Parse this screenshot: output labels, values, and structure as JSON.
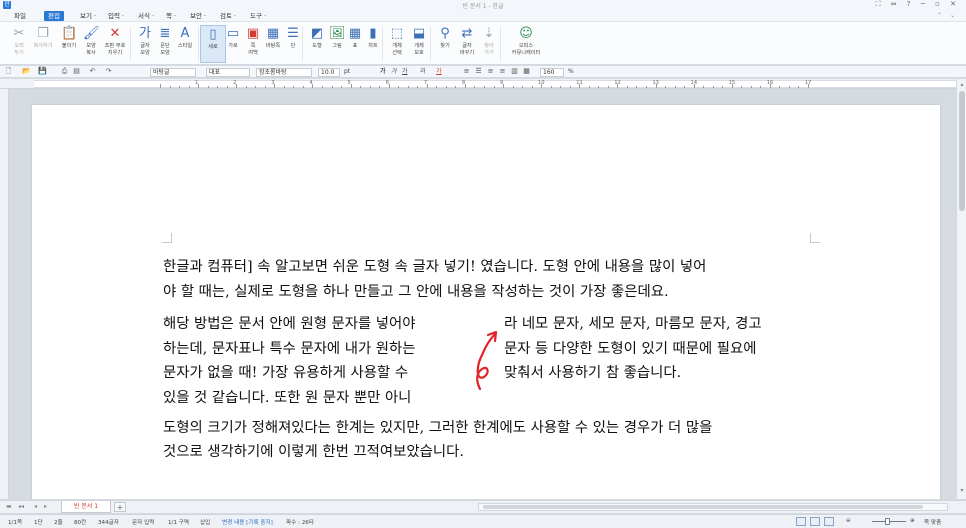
{
  "window": {
    "app_logo": "한",
    "title": "빈 문서 1 - 한글",
    "controls": "⛶ ⇔ ?  ─ ▫ ✕"
  },
  "menubar": {
    "items": [
      {
        "label": "파일",
        "active": false
      },
      {
        "label": "편집",
        "active": true
      },
      {
        "label": "보기 ·",
        "active": false
      },
      {
        "label": "입력 ·",
        "active": false
      },
      {
        "label": "서식 ·",
        "active": false
      },
      {
        "label": "쪽 ·",
        "active": false
      },
      {
        "label": "보안 ·",
        "active": false
      },
      {
        "label": "검토 ·",
        "active": false
      },
      {
        "label": "도구 ·",
        "active": false
      }
    ],
    "ribbon_arrows": "⌃ ⌄"
  },
  "ribbon": {
    "buttons": [
      {
        "name": "cut",
        "icon": "scissors-icon",
        "glyph": "✂",
        "label": "오려\n두기",
        "dim": true
      },
      {
        "name": "copy",
        "icon": "copy-icon",
        "glyph": "❐",
        "label": "복사하기",
        "dim": true
      },
      {
        "name": "paste",
        "icon": "paste-icon",
        "glyph": "📋",
        "label": "붙이기"
      },
      {
        "name": "shape-copy",
        "icon": "format-copy-icon",
        "glyph": "🖌",
        "label": "모양\n복사"
      },
      {
        "name": "delete-condition",
        "icon": "delete-x-icon",
        "glyph": "✕",
        "label": "조판 부호\n지우기"
      },
      {
        "name": "char-shape",
        "icon": "char-shape-icon",
        "glyph": "가",
        "label": "글자\n모양"
      },
      {
        "name": "para-shape",
        "icon": "para-shape-icon",
        "glyph": "≣",
        "label": "문단\n모양"
      },
      {
        "name": "style",
        "icon": "style-icon",
        "glyph": "A",
        "label": "스타일"
      },
      {
        "name": "portrait",
        "icon": "portrait-page-icon",
        "glyph": "▯",
        "label": "세로",
        "selected": true
      },
      {
        "name": "landscape",
        "icon": "landscape-page-icon",
        "glyph": "▭",
        "label": "가로"
      },
      {
        "name": "margin",
        "icon": "page-margin-icon",
        "glyph": "▣",
        "label": "쪽\n여백"
      },
      {
        "name": "bg",
        "icon": "page-bg-icon",
        "glyph": "▦",
        "label": "바탕쪽"
      },
      {
        "name": "columns",
        "icon": "columns-icon",
        "glyph": "☰",
        "label": "단"
      },
      {
        "name": "shape",
        "icon": "shape-icon",
        "glyph": "◩",
        "label": "도형"
      },
      {
        "name": "picture",
        "icon": "picture-icon",
        "glyph": "🖼",
        "label": "그림"
      },
      {
        "name": "table",
        "icon": "table-icon",
        "glyph": "▦",
        "label": "표"
      },
      {
        "name": "chart",
        "icon": "chart-icon",
        "glyph": "▮",
        "label": "차트"
      },
      {
        "name": "select-object",
        "icon": "object-select-icon",
        "glyph": "⬚",
        "label": "개체\n선택"
      },
      {
        "name": "object-protect",
        "icon": "object-protect-icon",
        "glyph": "⬓",
        "label": "개체\n보호"
      },
      {
        "name": "find",
        "icon": "binoculars-icon",
        "glyph": "⚲",
        "label": "찾기"
      },
      {
        "name": "replace",
        "icon": "replace-icon",
        "glyph": "⇄",
        "label": "글자\n바꾸기"
      },
      {
        "name": "goto",
        "icon": "goto-icon",
        "glyph": "⇣",
        "label": "찾아\n가기",
        "dim": true
      },
      {
        "name": "office",
        "icon": "office-comm-icon",
        "glyph": "☺",
        "label": "오피스\n커뮤니케이터"
      }
    ]
  },
  "format_toolbar": {
    "style_value": "바탕글",
    "lang_value": "대표",
    "font_value": "함초롬바탕",
    "size_value": "10.0",
    "size_unit": "pt",
    "zoom_value": "160",
    "zoom_unit": "%",
    "bold": "가",
    "italic": "가",
    "underline": "가",
    "strike": "과",
    "color_text": "가"
  },
  "ruler": {
    "numbers": [
      "1",
      "2",
      "3",
      "4",
      "5",
      "6",
      "7",
      "8",
      "9",
      "10",
      "11",
      "12",
      "13",
      "14",
      "15",
      "16",
      "17"
    ]
  },
  "document": {
    "lines": [
      "한글과 컴퓨터] 속 알고보면 쉬운 도형 속 글자 넣기! 였습니다. 도형 안에 내용을 많이 넣어",
      "야 할 때는, 실제로 도형을 하나 만들고 그 안에 내용을 작성하는 것이 가장 좋은데요.",
      "해당 방법은 문서 안에 원형  문자를 넣어야",
      "하는데, 문자표나 특수 문자에 내가 원하는",
      "문자가 없을 때! 가장 유용하게 사용할 수",
      "있을 것 같습니다. 또한 원 문자 뿐만 아니",
      "라 네모 문자, 세모 문자, 마름모 문자, 경고",
      "문자 등 다양한 도형이 있기 때문에 필요에",
      "맞춰서 사용하기 참 좋습니다.",
      "도형의 크기가 정해져있다는 한계는 있지만, 그러한 한계에도 사용할 수 있는 경우가 더 많을",
      "것으로 생각하기에 이렇게 한번 끄적여보았습니다."
    ],
    "annotation_color": "#e0242a"
  },
  "tabbar": {
    "doc_tab": "빈 문서 1",
    "add_tab": "+"
  },
  "status": {
    "page": "1/1쪽",
    "col": "1단",
    "line": "2줄",
    "chars": "80칸",
    "count": "344글자",
    "input": "문자 입력",
    "section": "1/1 구역",
    "mode": "삽입",
    "track": "변경 내용 [기록 중지]",
    "note": "파수 : 26타",
    "zoom_label": "쪽 맞춤"
  }
}
